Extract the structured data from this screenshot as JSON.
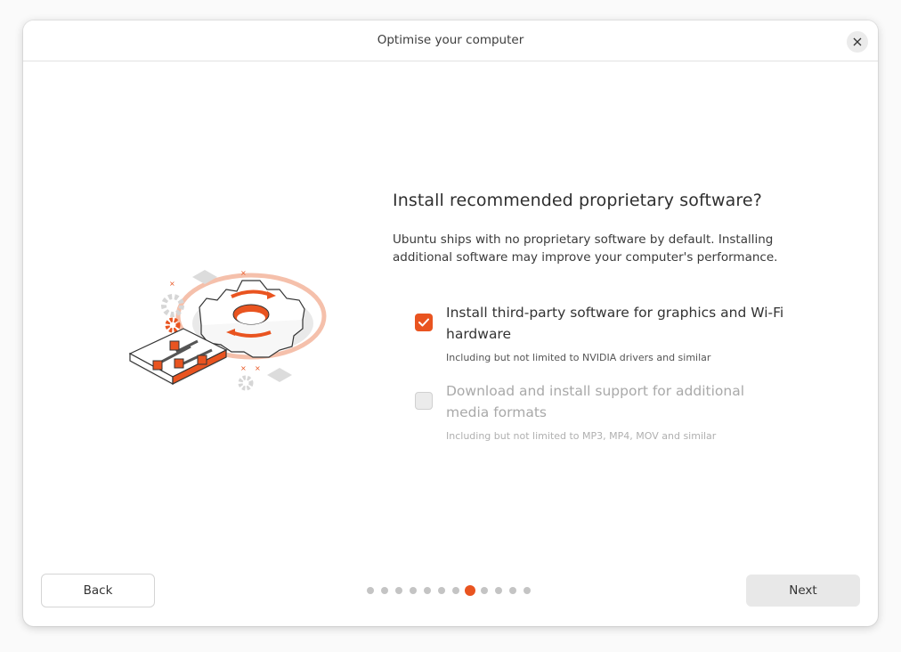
{
  "window": {
    "title": "Optimise your computer",
    "close_icon": "close-icon"
  },
  "main": {
    "heading": "Install recommended proprietary software?",
    "description": "Ubuntu ships with no proprietary software by default. Installing additional software may improve your computer's performance.",
    "illustration": "gear-settings-illustration",
    "options": [
      {
        "label": "Install third-party software for graphics and Wi-Fi hardware",
        "sublabel": "Including but not limited to NVIDIA drivers and similar",
        "checked": true,
        "enabled": true
      },
      {
        "label": "Download and install support for additional media formats",
        "sublabel": "Including but not limited to MP3, MP4, MOV and similar",
        "checked": false,
        "enabled": false
      }
    ]
  },
  "footer": {
    "back_label": "Back",
    "next_label": "Next",
    "progress": {
      "total_steps": 12,
      "current_step": 8
    }
  },
  "colors": {
    "accent": "#e95420",
    "inactive_dot": "#c4c4c4",
    "button_bg": "#e8e8e8"
  }
}
